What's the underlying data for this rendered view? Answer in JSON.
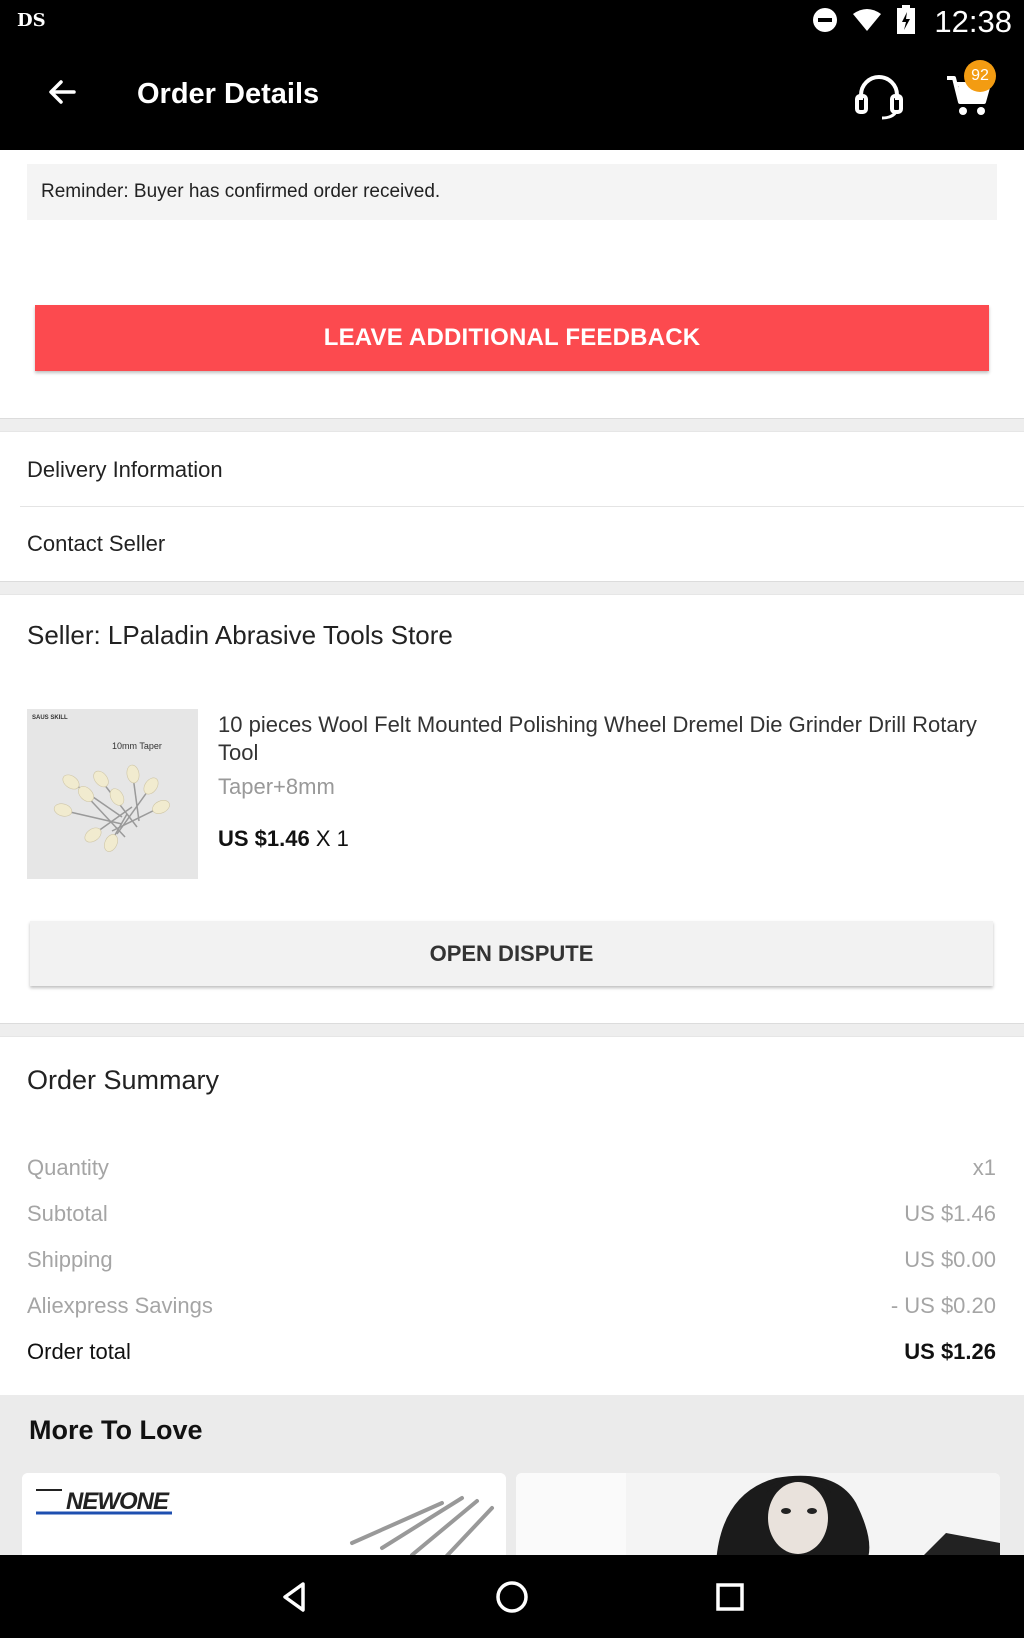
{
  "status_bar": {
    "carrier": "DS",
    "time": "12:38"
  },
  "header": {
    "title": "Order Details",
    "cart_count": "92"
  },
  "reminder": "Reminder: Buyer has confirmed order received.",
  "feedback_button": "LEAVE ADDITIONAL FEEDBACK",
  "links": {
    "delivery": "Delivery Information",
    "contact": "Contact Seller"
  },
  "seller": {
    "label": "Seller: LPaladin Abrasive Tools Store"
  },
  "product": {
    "image_label": "10mm Taper",
    "image_brand": "SAUS SKILL",
    "name": "10 pieces Wool Felt Mounted Polishing Wheel Dremel Die Grinder Drill Rotary Tool",
    "variant": "Taper+8mm",
    "price": "US $1.46",
    "qty": "X 1"
  },
  "dispute_button": "OPEN DISPUTE",
  "summary": {
    "title": "Order Summary",
    "rows": [
      {
        "label": "Quantity",
        "value": "x1"
      },
      {
        "label": "Subtotal",
        "value": "US $1.46"
      },
      {
        "label": "Shipping",
        "value": "US $0.00"
      },
      {
        "label": "Aliexpress Savings",
        "value": "- US $0.20"
      }
    ],
    "total": {
      "label": "Order total",
      "value": "US $1.26"
    }
  },
  "more": {
    "title": "More To Love",
    "card1_brand": "NEWONE"
  },
  "colors": {
    "accent": "#fc4a4f",
    "badge": "#f39c12",
    "bar": "#000000"
  },
  "icons": [
    "back-arrow-icon",
    "headset-icon",
    "cart-icon",
    "dnd-icon",
    "wifi-icon",
    "battery-icon",
    "nav-back-icon",
    "nav-home-icon",
    "nav-recents-icon"
  ]
}
